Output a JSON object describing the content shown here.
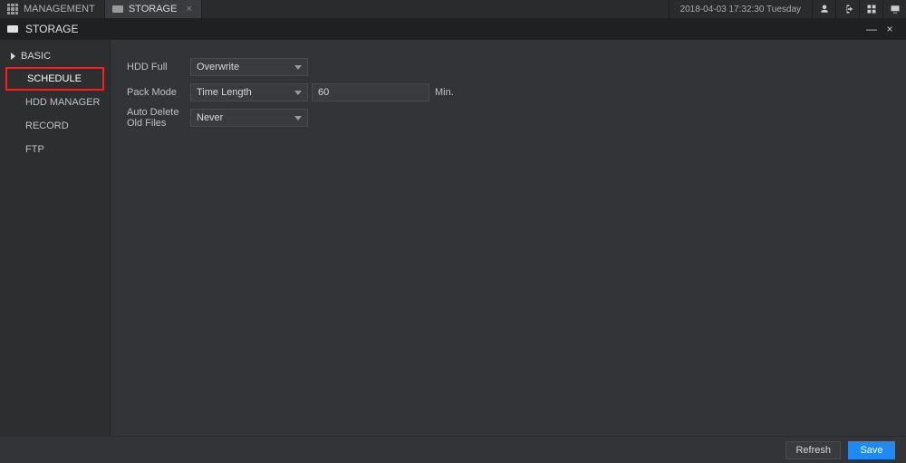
{
  "top_tabs": {
    "management": "MANAGEMENT",
    "storage": "STORAGE"
  },
  "top_right": {
    "timestamp": "2018-04-03 17:32:30 Tuesday"
  },
  "title": "STORAGE",
  "sidebar": {
    "category": "BASIC",
    "items": [
      "SCHEDULE",
      "HDD MANAGER",
      "RECORD",
      "FTP"
    ],
    "selected_index": 0
  },
  "form": {
    "hdd_full": {
      "label": "HDD Full",
      "value": "Overwrite"
    },
    "pack_mode": {
      "label": "Pack Mode",
      "value": "Time Length",
      "number": "60",
      "unit": "Min."
    },
    "auto_delete": {
      "label": "Auto Delete Old Files",
      "value": "Never"
    }
  },
  "footer": {
    "refresh": "Refresh",
    "save": "Save"
  }
}
